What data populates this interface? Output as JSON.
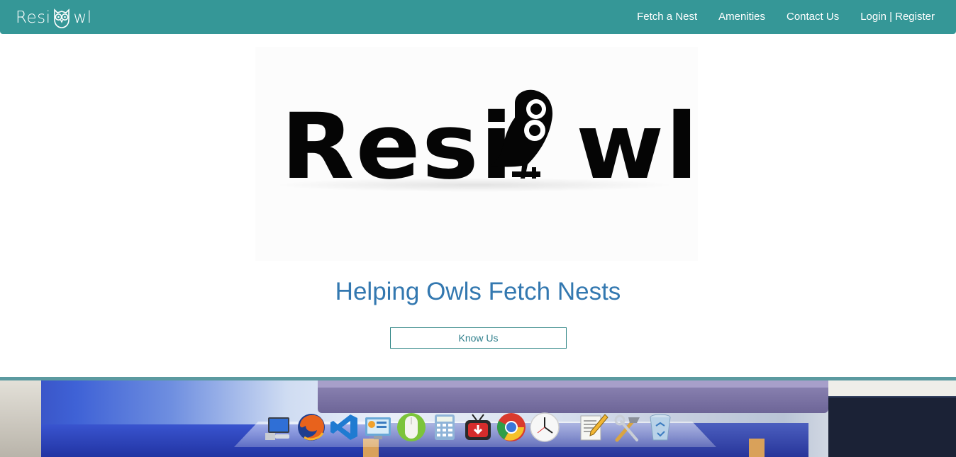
{
  "navbar": {
    "brand_prefix": "Resi",
    "brand_suffix": "wl",
    "links": [
      {
        "label": "Fetch a Nest"
      },
      {
        "label": "Amenities"
      },
      {
        "label": "Contact Us"
      },
      {
        "label": "Login | Register"
      }
    ],
    "background": "#359797"
  },
  "hero": {
    "logo_prefix": "Resi",
    "logo_suffix": "wl",
    "tagline": "Helping Owls Fetch Nests",
    "cta_label": "Know Us",
    "tagline_color": "#3378b0"
  },
  "dock": {
    "items": [
      {
        "icon": "computer-icon"
      },
      {
        "icon": "firefox-icon"
      },
      {
        "icon": "visual-studio-code-icon"
      },
      {
        "icon": "control-panel-icon"
      },
      {
        "icon": "mouse-icon"
      },
      {
        "icon": "calculator-icon"
      },
      {
        "icon": "downloader-icon"
      },
      {
        "icon": "chrome-icon"
      },
      {
        "icon": "clock-icon"
      },
      {
        "icon": "text-editor-icon"
      },
      {
        "icon": "system-tools-icon"
      },
      {
        "icon": "recycle-bin-icon"
      }
    ]
  }
}
